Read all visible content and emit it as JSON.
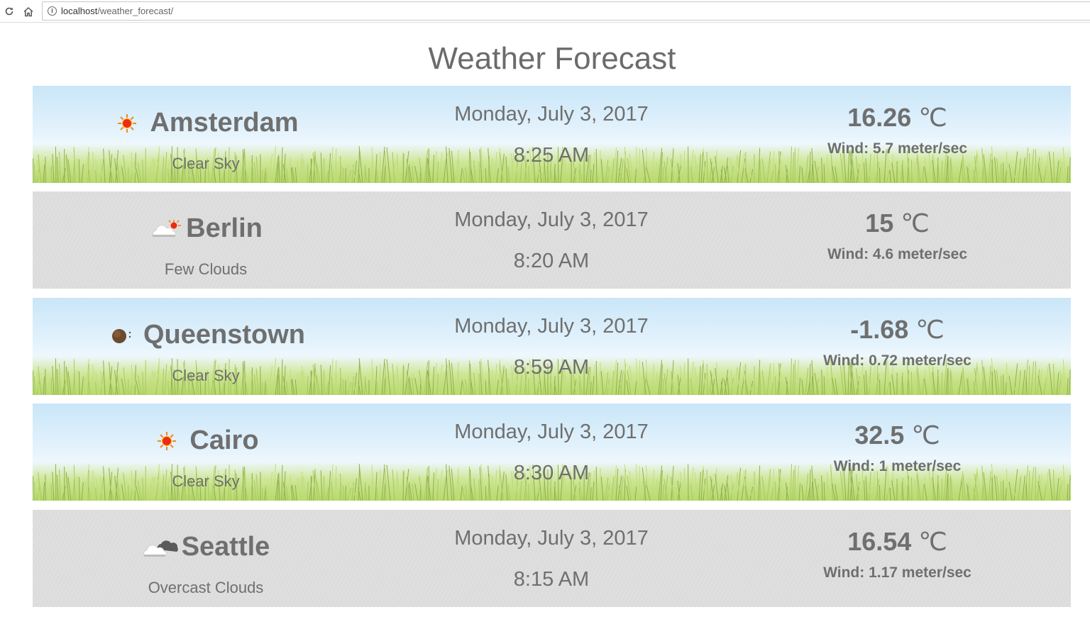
{
  "browser": {
    "url_host": "localhost",
    "url_path": "/weather_forecast/"
  },
  "page": {
    "title": "Weather Forecast"
  },
  "forecasts": [
    {
      "city": "Amsterdam",
      "description": "Clear Sky",
      "date": "Monday, July 3, 2017",
      "time": "8:25 AM",
      "temperature": "16.26",
      "unit": "℃",
      "wind": "Wind: 5.7 meter/sec",
      "icon": "sun-icon",
      "background": "sunny-grass"
    },
    {
      "city": "Berlin",
      "description": "Few Clouds",
      "date": "Monday, July 3, 2017",
      "time": "8:20 AM",
      "temperature": "15",
      "unit": "℃",
      "wind": "Wind: 4.6 meter/sec",
      "icon": "few-clouds-icon",
      "background": "gray-rain"
    },
    {
      "city": "Queenstown",
      "description": "Clear Sky",
      "date": "Monday, July 3, 2017",
      "time": "8:59 AM",
      "temperature": "-1.68",
      "unit": "℃",
      "wind": "Wind: 0.72 meter/sec",
      "icon": "moon-icon",
      "background": "sunny-grass"
    },
    {
      "city": "Cairo",
      "description": "Clear Sky",
      "date": "Monday, July 3, 2017",
      "time": "8:30 AM",
      "temperature": "32.5",
      "unit": "℃",
      "wind": "Wind: 1 meter/sec",
      "icon": "sun-icon",
      "background": "sunny-grass"
    },
    {
      "city": "Seattle",
      "description": "Overcast Clouds",
      "date": "Monday, July 3, 2017",
      "time": "8:15 AM",
      "temperature": "16.54",
      "unit": "℃",
      "wind": "Wind: 1.17 meter/sec",
      "icon": "overcast-clouds-icon",
      "background": "gray-rain"
    }
  ]
}
